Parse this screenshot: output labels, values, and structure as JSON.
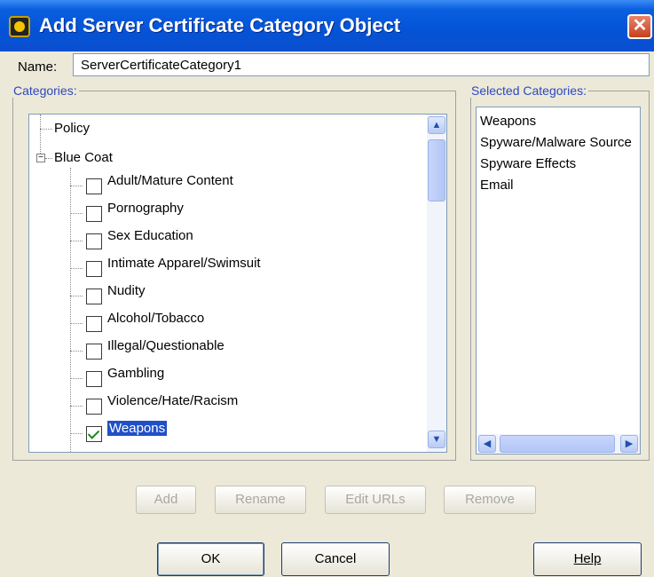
{
  "window": {
    "title": "Add Server Certificate Category Object",
    "close_glyph": "✕"
  },
  "name_field": {
    "label": "Name:",
    "value": "ServerCertificateCategory1"
  },
  "categories": {
    "legend": "Categories:",
    "tree": {
      "top_items": [
        {
          "label": "Policy",
          "expanded": false
        },
        {
          "label": "Blue Coat",
          "expanded": true
        }
      ],
      "expander_glyph": "−",
      "children": [
        {
          "label": "Adult/Mature Content",
          "checked": false
        },
        {
          "label": "Pornography",
          "checked": false
        },
        {
          "label": "Sex Education",
          "checked": false
        },
        {
          "label": "Intimate Apparel/Swimsuit",
          "checked": false
        },
        {
          "label": "Nudity",
          "checked": false
        },
        {
          "label": "Alcohol/Tobacco",
          "checked": false
        },
        {
          "label": "Illegal/Questionable",
          "checked": false
        },
        {
          "label": "Gambling",
          "checked": false
        },
        {
          "label": "Violence/Hate/Racism",
          "checked": false
        },
        {
          "label": "Weapons",
          "checked": true,
          "selected": true
        }
      ]
    },
    "scroll_up_glyph": "▲",
    "scroll_down_glyph": "▼"
  },
  "selected_categories": {
    "legend": "Selected Categories:",
    "items": [
      "Weapons",
      "Spyware/Malware Source",
      "Spyware Effects",
      "Email"
    ],
    "scroll_left_glyph": "◀",
    "scroll_right_glyph": "▶"
  },
  "action_buttons": {
    "add": "Add",
    "rename": "Rename",
    "edit_urls": "Edit URLs",
    "remove": "Remove"
  },
  "dialog_buttons": {
    "ok": "OK",
    "cancel": "Cancel",
    "help": "Help"
  }
}
